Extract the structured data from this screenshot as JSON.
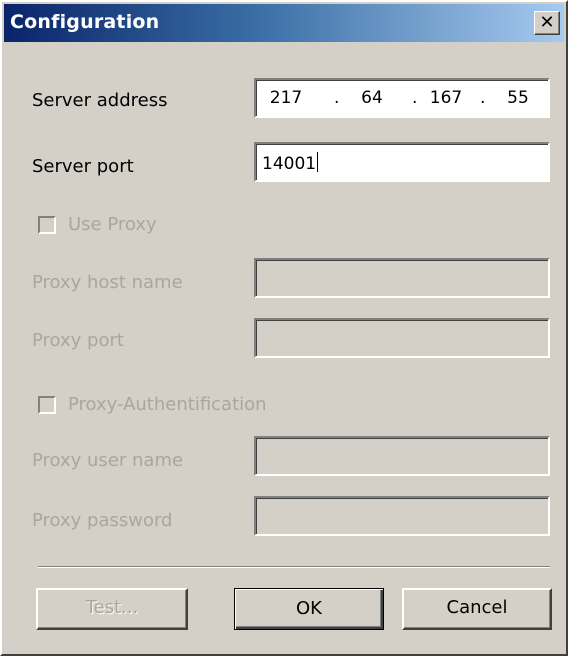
{
  "window": {
    "title": "Configuration",
    "close_glyph": "✕"
  },
  "fields": {
    "server_address": {
      "label": "Server address",
      "octets": [
        "217",
        "64",
        "167",
        "55"
      ],
      "dot": "."
    },
    "server_port": {
      "label": "Server port",
      "value": "14001"
    },
    "use_proxy": {
      "label": "Use Proxy",
      "checked": false,
      "enabled": false
    },
    "proxy_host": {
      "label": "Proxy host name",
      "value": "",
      "enabled": false
    },
    "proxy_port": {
      "label": "Proxy port",
      "value": "",
      "enabled": false
    },
    "proxy_auth": {
      "label": "Proxy-Authentification",
      "checked": false,
      "enabled": false
    },
    "proxy_user": {
      "label": "Proxy user name",
      "value": "",
      "enabled": false
    },
    "proxy_password": {
      "label": "Proxy password",
      "value": "",
      "enabled": false
    }
  },
  "buttons": {
    "test": "Test...",
    "ok": "OK",
    "cancel": "Cancel"
  },
  "icons": {
    "close": "close-icon"
  },
  "colors": {
    "titlebar_start": "#0a246a",
    "titlebar_end": "#a6caf0",
    "face": "#d4d0c8",
    "disabled_text": "#a9a69e"
  }
}
